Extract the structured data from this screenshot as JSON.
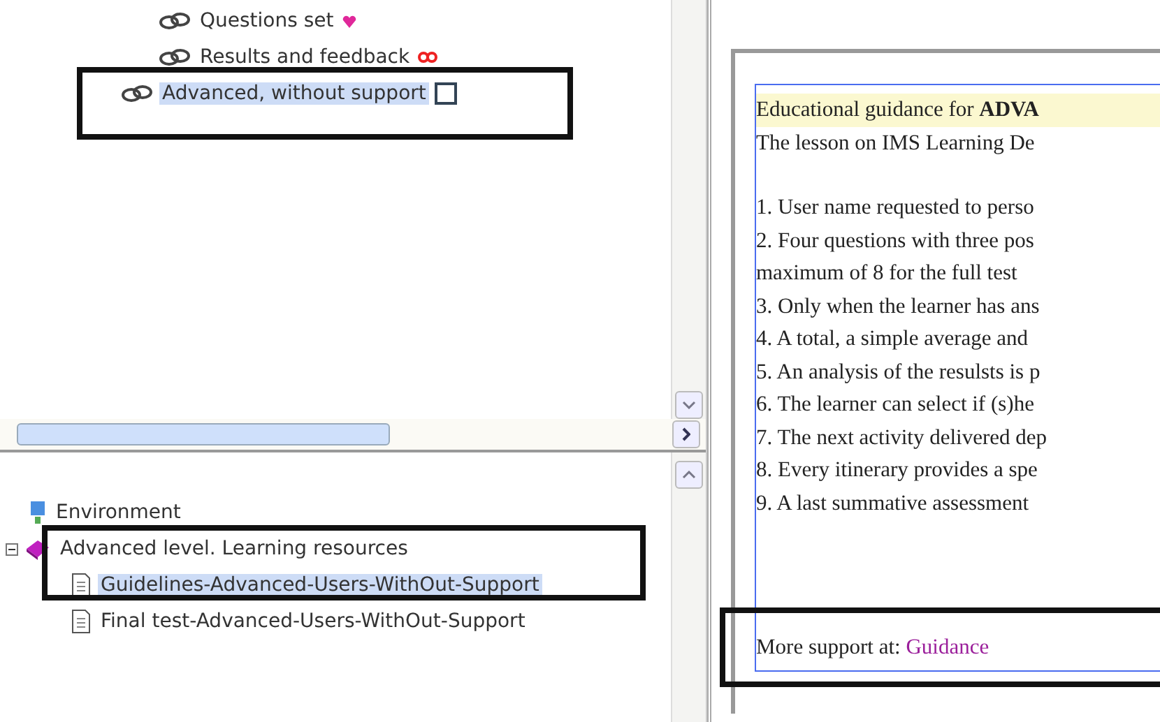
{
  "activity_tree": {
    "items": [
      {
        "label": "Questions set",
        "kind": "heart",
        "selected": false
      },
      {
        "label": "Results and feedback",
        "kind": "loop",
        "selected": false
      },
      {
        "label": "Advanced, without support",
        "kind": "checkbox",
        "checked": false,
        "selected": true
      }
    ]
  },
  "resource_tree": {
    "label": "Environment",
    "children": [
      {
        "label": "Advanced level. Learning resources",
        "expanded": true,
        "selected": false,
        "children": [
          {
            "label": "Guidelines-Advanced-Users-WithOut-Support",
            "selected": true
          },
          {
            "label": "Final test-Advanced-Users-WithOut-Support",
            "selected": false
          }
        ]
      }
    ]
  },
  "document": {
    "heading": "Educational guidance for **ADVA**",
    "intro": "The lesson on IMS Learning De",
    "lines": [
      "1. User name requested to perso",
      "2. Four questions with three pos",
      "maximum of 8 for the full test",
      "3. Only when the learner has ans",
      "4. A total, a simple average and",
      "5. An analysis of the resulsts is p",
      "6. The learner can select if (s)he",
      "7. The next activity delivered dep",
      "8. Every itinerary provides a spe",
      "9. A last summative assessment"
    ],
    "footer": {
      "text": "More support at:",
      "link": "Guidance"
    }
  }
}
